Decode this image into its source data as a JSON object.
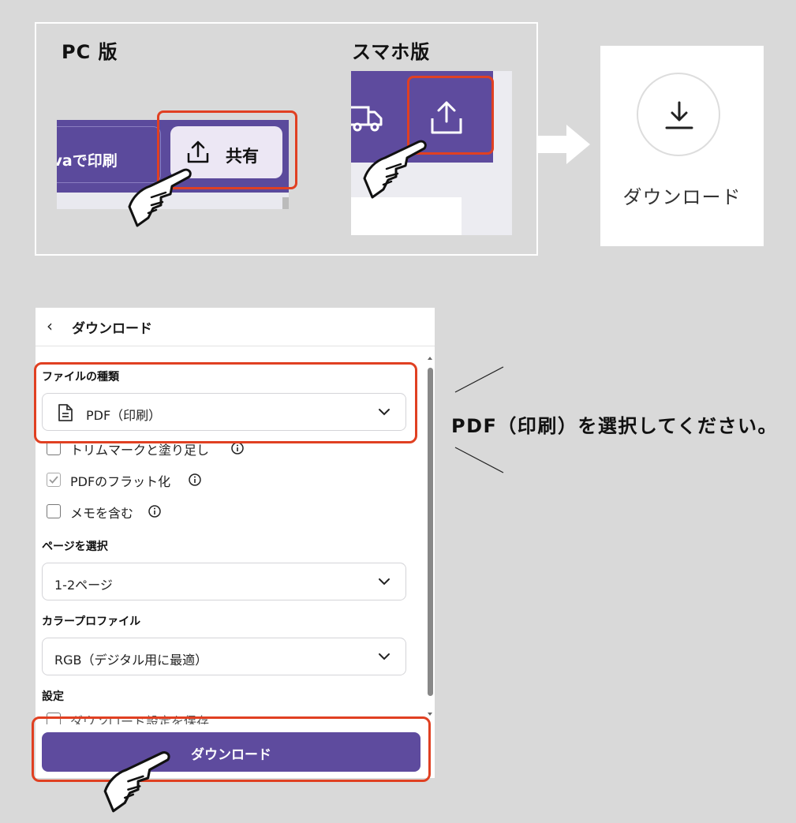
{
  "top": {
    "pc_label": "PC 版",
    "sp_label": "スマホ版",
    "pc_print_text": "nvaで印刷",
    "pc_share_text": "共有",
    "download_card_label": "ダウンロード"
  },
  "panel": {
    "title": "ダウンロード",
    "file_type_label": "ファイルの種類",
    "file_type_value": "PDF（印刷）",
    "checkboxes": [
      {
        "label": "トリムマークと塗り足し",
        "checked": false
      },
      {
        "label": "PDFのフラット化",
        "checked": true
      },
      {
        "label": "メモを含む",
        "checked": false
      }
    ],
    "pages_label": "ページを選択",
    "pages_value": "1-2ページ",
    "color_profile_label": "カラープロファイル",
    "color_profile_value": "RGB（デジタル用に最適）",
    "settings_label": "設定",
    "save_settings_label": "ダウンロード設定を保存",
    "download_button": "ダウンロード"
  },
  "callout": "PDF（印刷）を選択してください。",
  "colors": {
    "accent": "#5e4b9e",
    "highlight": "#e04022",
    "background": "#d9d9d9"
  }
}
